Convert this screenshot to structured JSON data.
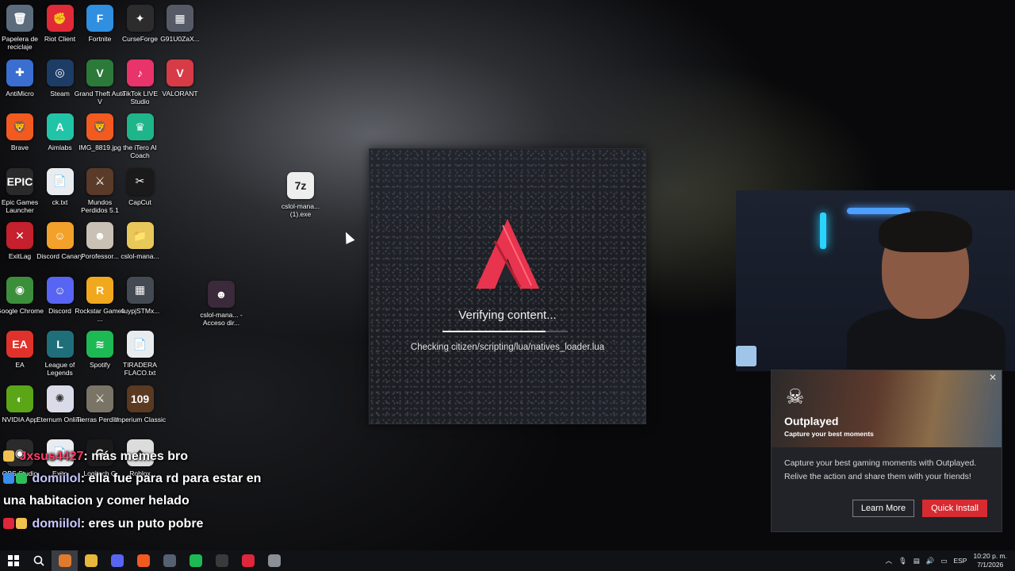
{
  "desktop": {
    "icons": [
      {
        "label": "Papelera de reciclaje",
        "glyph": "🗑",
        "color": "#5c6c7c",
        "col": 0,
        "row": 0
      },
      {
        "label": "Riot Client",
        "glyph": "✊",
        "color": "#e02a37",
        "col": 1,
        "row": 0
      },
      {
        "label": "Fortnite",
        "glyph": "F",
        "color": "#2f8fe0",
        "col": 2,
        "row": 0
      },
      {
        "label": "CurseForge",
        "glyph": "✦",
        "color": "#2c2c2c",
        "col": 3,
        "row": 0
      },
      {
        "label": "G91U0ZaX...",
        "glyph": "▦",
        "color": "#555a66",
        "col": 4,
        "row": 0
      },
      {
        "label": "AntiMicro",
        "glyph": "✚",
        "color": "#3a6ed0",
        "col": 0,
        "row": 1
      },
      {
        "label": "Steam",
        "glyph": "◎",
        "color": "#1d3c66",
        "col": 1,
        "row": 1
      },
      {
        "label": "Grand Theft Auto V",
        "glyph": "V",
        "color": "#2b7a3a",
        "col": 2,
        "row": 1
      },
      {
        "label": "TikTok LIVE Studio",
        "glyph": "♪",
        "color": "#e8336b",
        "col": 3,
        "row": 1
      },
      {
        "label": "VALORANT",
        "glyph": "V",
        "color": "#d63b46",
        "col": 4,
        "row": 1
      },
      {
        "label": "Brave",
        "glyph": "🦁",
        "color": "#f25a20",
        "col": 0,
        "row": 2
      },
      {
        "label": "Aimlabs",
        "glyph": "A",
        "color": "#22c4a8",
        "col": 1,
        "row": 2
      },
      {
        "label": "IMG_8819.jpg",
        "glyph": "🦁",
        "color": "#f25a20",
        "col": 2,
        "row": 2
      },
      {
        "label": "the iTero AI Coach",
        "glyph": "♛",
        "color": "#1fb58a",
        "col": 3,
        "row": 2
      },
      {
        "label": "Epic Games Launcher",
        "glyph": "EPIC",
        "color": "#2a2a2a",
        "col": 0,
        "row": 3
      },
      {
        "label": "ck.txt",
        "glyph": "📄",
        "color": "#e9ecef",
        "col": 1,
        "row": 3
      },
      {
        "label": "Mundos Perdidos 5.1",
        "glyph": "⚔",
        "color": "#5a3a28",
        "col": 2,
        "row": 3
      },
      {
        "label": "CapCut",
        "glyph": "✂",
        "color": "#1a1a1a",
        "col": 3,
        "row": 3
      },
      {
        "label": "ExitLag",
        "glyph": "✕",
        "color": "#c4202d",
        "col": 0,
        "row": 4
      },
      {
        "label": "Discord Canary",
        "glyph": "☺",
        "color": "#f2a12a",
        "col": 1,
        "row": 4
      },
      {
        "label": "Porofessor...",
        "glyph": "☻",
        "color": "#c9c1b4",
        "col": 2,
        "row": 4
      },
      {
        "label": "cslol-mana...",
        "glyph": "📁",
        "color": "#e8c85a",
        "col": 3,
        "row": 4
      },
      {
        "label": "Google Chrome",
        "glyph": "◉",
        "color": "#3c8f3a",
        "col": 0,
        "row": 5
      },
      {
        "label": "Discord",
        "glyph": "☺",
        "color": "#5865f2",
        "col": 1,
        "row": 5
      },
      {
        "label": "Rockstar Games ...",
        "glyph": "R",
        "color": "#f2a81d",
        "col": 2,
        "row": 5
      },
      {
        "label": "4uypjSTMx...",
        "glyph": "▦",
        "color": "#444a52",
        "col": 3,
        "row": 5
      },
      {
        "label": "EA",
        "glyph": "EA",
        "color": "#e0322b",
        "col": 0,
        "row": 6
      },
      {
        "label": "League of Legends",
        "glyph": "L",
        "color": "#1f6f7a",
        "col": 1,
        "row": 6
      },
      {
        "label": "Spotify",
        "glyph": "≋",
        "color": "#1db954",
        "col": 2,
        "row": 6
      },
      {
        "label": "TIRADERA FLACO.txt",
        "glyph": "📄",
        "color": "#e9ecef",
        "col": 3,
        "row": 6
      },
      {
        "label": "NVIDIA App",
        "glyph": "◐",
        "color": "#5aa617",
        "col": 0,
        "row": 7
      },
      {
        "label": "Eternum Online",
        "glyph": "✺",
        "color": "#d9dce8",
        "col": 1,
        "row": 7
      },
      {
        "label": "Tierras Perdid...",
        "glyph": "⚔",
        "color": "#7a7466",
        "col": 2,
        "row": 7
      },
      {
        "label": "Imperium Classic",
        "glyph": "109",
        "color": "#5a3a20",
        "col": 3,
        "row": 7
      },
      {
        "label": "OBS Studio",
        "glyph": "◉",
        "color": "#2b2b2b",
        "col": 0,
        "row": 8
      },
      {
        "label": "Exito",
        "glyph": "📄",
        "color": "#e9ecef",
        "col": 1,
        "row": 8
      },
      {
        "label": "Logitech G",
        "glyph": "G",
        "color": "#1a1a1a",
        "col": 2,
        "row": 8
      },
      {
        "label": "Roblox",
        "glyph": "◆",
        "color": "#dcdcdc",
        "col": 3,
        "row": 8
      }
    ],
    "extra_icons": [
      {
        "label": "cslol-mana... (1).exe",
        "glyph": "7z",
        "color": "#eeeeee"
      },
      {
        "label": "cslol-mana... - Acceso dir...",
        "glyph": "☻",
        "color": "#3b2a3a"
      }
    ]
  },
  "launcher": {
    "status": "Verifying content...",
    "progress": 0.82,
    "detail": "Checking citizen/scripting/lua/natives_loader.lua",
    "accent": "#e8344e"
  },
  "outplayed": {
    "brand": "Outplayed",
    "tagline": "Capture your best moments",
    "description": "Capture your best gaming moments with Outplayed. Relive the action and share them with your friends!",
    "learn_more": "Learn More",
    "quick_install": "Quick Install",
    "accent": "#d62b31"
  },
  "chat": [
    {
      "user": "Jxsus4427",
      "message": ": más memes bro"
    },
    {
      "user": "domiilol",
      "message": ": ella fue para rd para estar en una habitacion y comer helado"
    },
    {
      "user": "domiilol",
      "message": ": eres un puto pobre"
    }
  ],
  "taskbar": {
    "apps": [
      {
        "name": "league-client",
        "color": "#e07a2c"
      },
      {
        "name": "file-explorer",
        "color": "#e8b83a"
      },
      {
        "name": "discord",
        "color": "#5865f2"
      },
      {
        "name": "brave",
        "color": "#f25a20"
      },
      {
        "name": "calculator",
        "color": "#556070"
      },
      {
        "name": "spotify",
        "color": "#1db954"
      },
      {
        "name": "obs",
        "color": "#3a3a3a"
      },
      {
        "name": "opera",
        "color": "#e0263a"
      },
      {
        "name": "settings",
        "color": "#8b8f96"
      }
    ],
    "language": "ESP",
    "time": "10:20 p. m.",
    "date": "7/1/2026"
  }
}
